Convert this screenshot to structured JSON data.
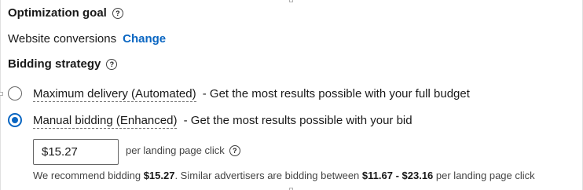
{
  "optimization": {
    "title": "Optimization goal",
    "help_icon": "question-circle-icon",
    "value": "Website conversions",
    "change_label": "Change"
  },
  "bidding": {
    "title": "Bidding strategy",
    "help_icon": "question-circle-icon",
    "options": [
      {
        "label": "Maximum delivery (Automated)",
        "description": "- Get the most results possible with your full budget",
        "selected": false
      },
      {
        "label": "Manual bidding (Enhanced)",
        "description": "- Get the most results possible with your bid",
        "selected": true
      }
    ],
    "bid_value": "$15.27",
    "bid_unit": "per landing page click",
    "recommendation": {
      "prefix": "We recommend bidding",
      "recommended": "$15.27",
      "middle": ". Similar advertisers are bidding between",
      "range": "$11.67 - $23.16",
      "suffix": "per landing page click"
    }
  },
  "colors": {
    "accent": "#0a66c2",
    "text": "#000000e6"
  }
}
